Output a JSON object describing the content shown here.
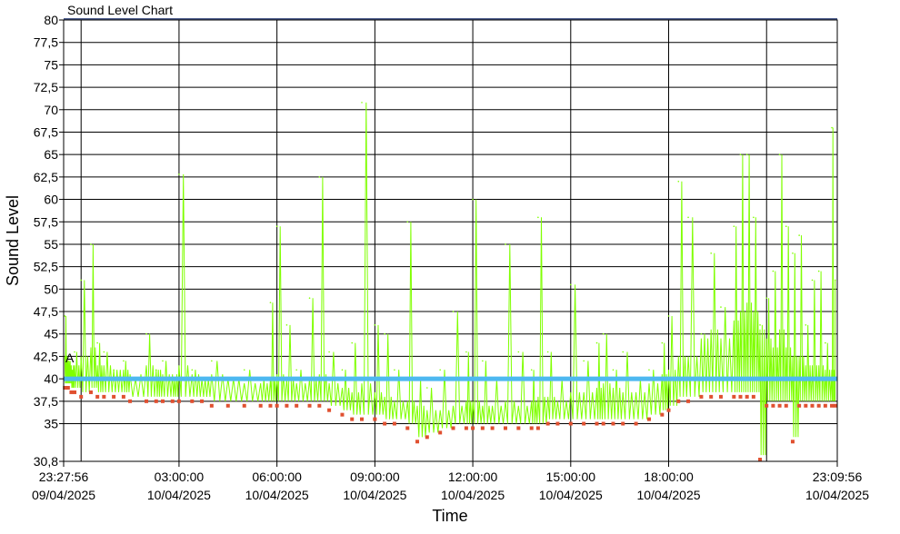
{
  "chart_data": {
    "type": "line",
    "title": "Sound Level Chart",
    "xlabel": "Time",
    "ylabel": "Sound Level",
    "ylim": [
      30.8,
      80
    ],
    "y_ticks": [
      "80",
      "77,5",
      "75",
      "72,5",
      "70",
      "67,5",
      "65",
      "62,5",
      "60",
      "57,5",
      "55",
      "52,5",
      "50",
      "47,5",
      "45",
      "42,5",
      "40",
      "37,5",
      "35",
      "30,8"
    ],
    "y_tick_values": [
      80,
      77.5,
      75,
      72.5,
      70,
      67.5,
      65,
      62.5,
      60,
      57.5,
      55,
      52.5,
      50,
      47.5,
      45,
      42.5,
      40,
      37.5,
      35,
      30.8
    ],
    "x_range_hours": [
      -0.535,
      23.166
    ],
    "x_ticks": [
      {
        "time": "23:27:56",
        "date": "09/04/2025",
        "hour": -0.535
      },
      {
        "time": "03:00:00",
        "date": "10/04/2025",
        "hour": 3
      },
      {
        "time": "06:00:00",
        "date": "10/04/2025",
        "hour": 6
      },
      {
        "time": "09:00:00",
        "date": "10/04/2025",
        "hour": 9
      },
      {
        "time": "12:00:00",
        "date": "10/04/2025",
        "hour": 12
      },
      {
        "time": "15:00:00",
        "date": "10/04/2025",
        "hour": 15
      },
      {
        "time": "18:00:00",
        "date": "10/04/2025",
        "hour": 18
      },
      {
        "time": "23:09:56",
        "date": "10/04/2025",
        "hour": 23.166
      }
    ],
    "threshold": {
      "label": "A",
      "value": 40,
      "color": "#4db8f0"
    },
    "series": [
      {
        "color": "#7fff00",
        "min_color": "#e05030",
        "x_hours": [
          -0.5,
          -0.4,
          -0.3,
          -0.2,
          0,
          0.3,
          0.5,
          0.7,
          1,
          1.3,
          1.5,
          2,
          2.3,
          2.5,
          2.8,
          3,
          3.4,
          3.7,
          4,
          4.5,
          5,
          5.5,
          5.8,
          6,
          6.3,
          6.6,
          7,
          7.3,
          7.6,
          8,
          8.3,
          8.6,
          9,
          9.3,
          9.6,
          10,
          10.3,
          10.6,
          11,
          11.4,
          11.8,
          12,
          12.3,
          12.6,
          13,
          13.4,
          13.8,
          14,
          14.3,
          14.6,
          15,
          15.4,
          15.8,
          16,
          16.3,
          16.6,
          17,
          17.4,
          17.8,
          18,
          18.3,
          18.6,
          19,
          19.3,
          19.6,
          20,
          20.2,
          20.4,
          20.6,
          20.8,
          21,
          21.2,
          21.4,
          21.6,
          21.8,
          22,
          22.2,
          22.4,
          22.6,
          22.8,
          23,
          23.1
        ],
        "max": [
          47,
          42,
          41,
          43,
          51,
          55,
          44,
          43,
          41,
          42,
          40,
          45,
          41,
          42,
          40,
          62.8,
          41,
          40,
          42,
          40,
          41,
          40,
          48.5,
          57,
          46,
          41,
          49,
          62.5,
          43,
          41,
          44,
          70.8,
          46,
          45,
          41,
          57.5,
          40,
          39,
          41,
          47.5,
          43,
          60,
          42,
          40,
          55,
          43,
          41,
          58,
          43,
          40,
          50.5,
          42,
          44,
          45,
          41,
          43,
          40,
          41,
          44,
          47,
          62,
          58,
          45,
          54,
          48,
          57,
          65,
          65,
          58,
          46,
          49,
          52,
          65,
          57,
          54,
          56,
          46,
          51,
          52,
          44,
          68,
          51
        ],
        "avg": [
          41,
          40.5,
          40,
          40,
          41,
          42,
          40,
          40,
          39.5,
          39.5,
          39,
          40,
          39.5,
          39,
          39,
          40,
          39,
          38.5,
          39,
          38.5,
          38,
          38,
          38.5,
          39,
          38.5,
          38,
          38.5,
          39,
          38,
          37.5,
          37,
          38,
          37,
          36.5,
          36,
          36,
          35.5,
          35,
          35,
          35.5,
          36,
          36,
          35.5,
          35.5,
          36,
          35.5,
          36,
          36.5,
          36.5,
          36,
          37,
          37,
          37.5,
          38,
          37.5,
          37,
          37,
          38,
          39,
          39.5,
          41,
          41,
          43,
          44,
          43,
          45,
          46,
          47,
          46,
          44,
          43,
          42,
          44,
          42,
          41,
          41,
          40,
          40,
          40,
          39.5,
          39.5,
          39
        ],
        "min": [
          39,
          39,
          38.5,
          38.5,
          38,
          38.5,
          38,
          38,
          38,
          38,
          37.5,
          37.5,
          37.5,
          37.5,
          37.5,
          37.5,
          37.5,
          37.5,
          37,
          37,
          37,
          37,
          37,
          37,
          37,
          37,
          37,
          37,
          36.5,
          36,
          35.5,
          35.5,
          35.5,
          35,
          35,
          34.5,
          33,
          33.5,
          34,
          34.5,
          34.5,
          34.5,
          34.5,
          34.5,
          34.5,
          34.5,
          34.5,
          34.5,
          35,
          35,
          35,
          35,
          35,
          35,
          35,
          35,
          35,
          35.5,
          36,
          36.5,
          37.5,
          37.5,
          38,
          38,
          38,
          38,
          38,
          38,
          38,
          31,
          37,
          37,
          37,
          37,
          33,
          37,
          37,
          37,
          37,
          37,
          37,
          37
        ]
      }
    ]
  }
}
